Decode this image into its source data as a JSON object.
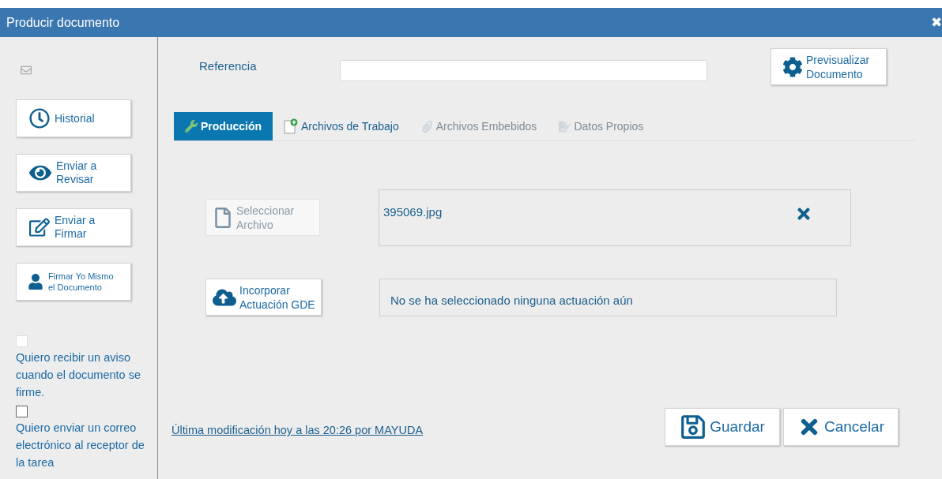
{
  "window": {
    "title": "Producir documento",
    "close": "✖"
  },
  "sidebar": {
    "buttons": [
      {
        "kind": "clock",
        "label": "Historial"
      },
      {
        "kind": "eye",
        "label": "Enviar a Revisar"
      },
      {
        "kind": "edit",
        "label": "Enviar a Firmar"
      },
      {
        "kind": "user",
        "label": "Firmar Yo Mismo el Documento"
      }
    ],
    "options": [
      {
        "checked": false,
        "label": "Quiero recibir un aviso cuando el documento se firme."
      },
      {
        "checked": false,
        "label": "Quiero enviar un correo electrónico al receptor de la tarea"
      }
    ]
  },
  "reference": {
    "label": "Referencia"
  },
  "preview_button": {
    "label": "Previsualizar Documento"
  },
  "tabs": [
    {
      "kind": "wrench",
      "label": "Producción",
      "selected": true,
      "disabled": false
    },
    {
      "kind": "add-file",
      "label": "Archivos de Trabajo",
      "selected": false,
      "disabled": false
    },
    {
      "kind": "clip",
      "label": "Archivos Embebidos",
      "selected": false,
      "disabled": true
    },
    {
      "kind": "note",
      "label": "Datos Propios",
      "selected": false,
      "disabled": true
    }
  ],
  "file_row": {
    "button": "Seleccionar Archivo",
    "disabled": true,
    "file": "395069.jpg"
  },
  "gde_row": {
    "button": "Incorporar Actuación GDE",
    "status": "No se ha seleccionado ninguna actuación aún"
  },
  "last_modified": "Última modificación hoy a las 20:26 por MAYUDA",
  "actions": [
    {
      "kind": "save",
      "label": "Guardar"
    },
    {
      "kind": "cancel",
      "label": "Cancelar"
    }
  ]
}
